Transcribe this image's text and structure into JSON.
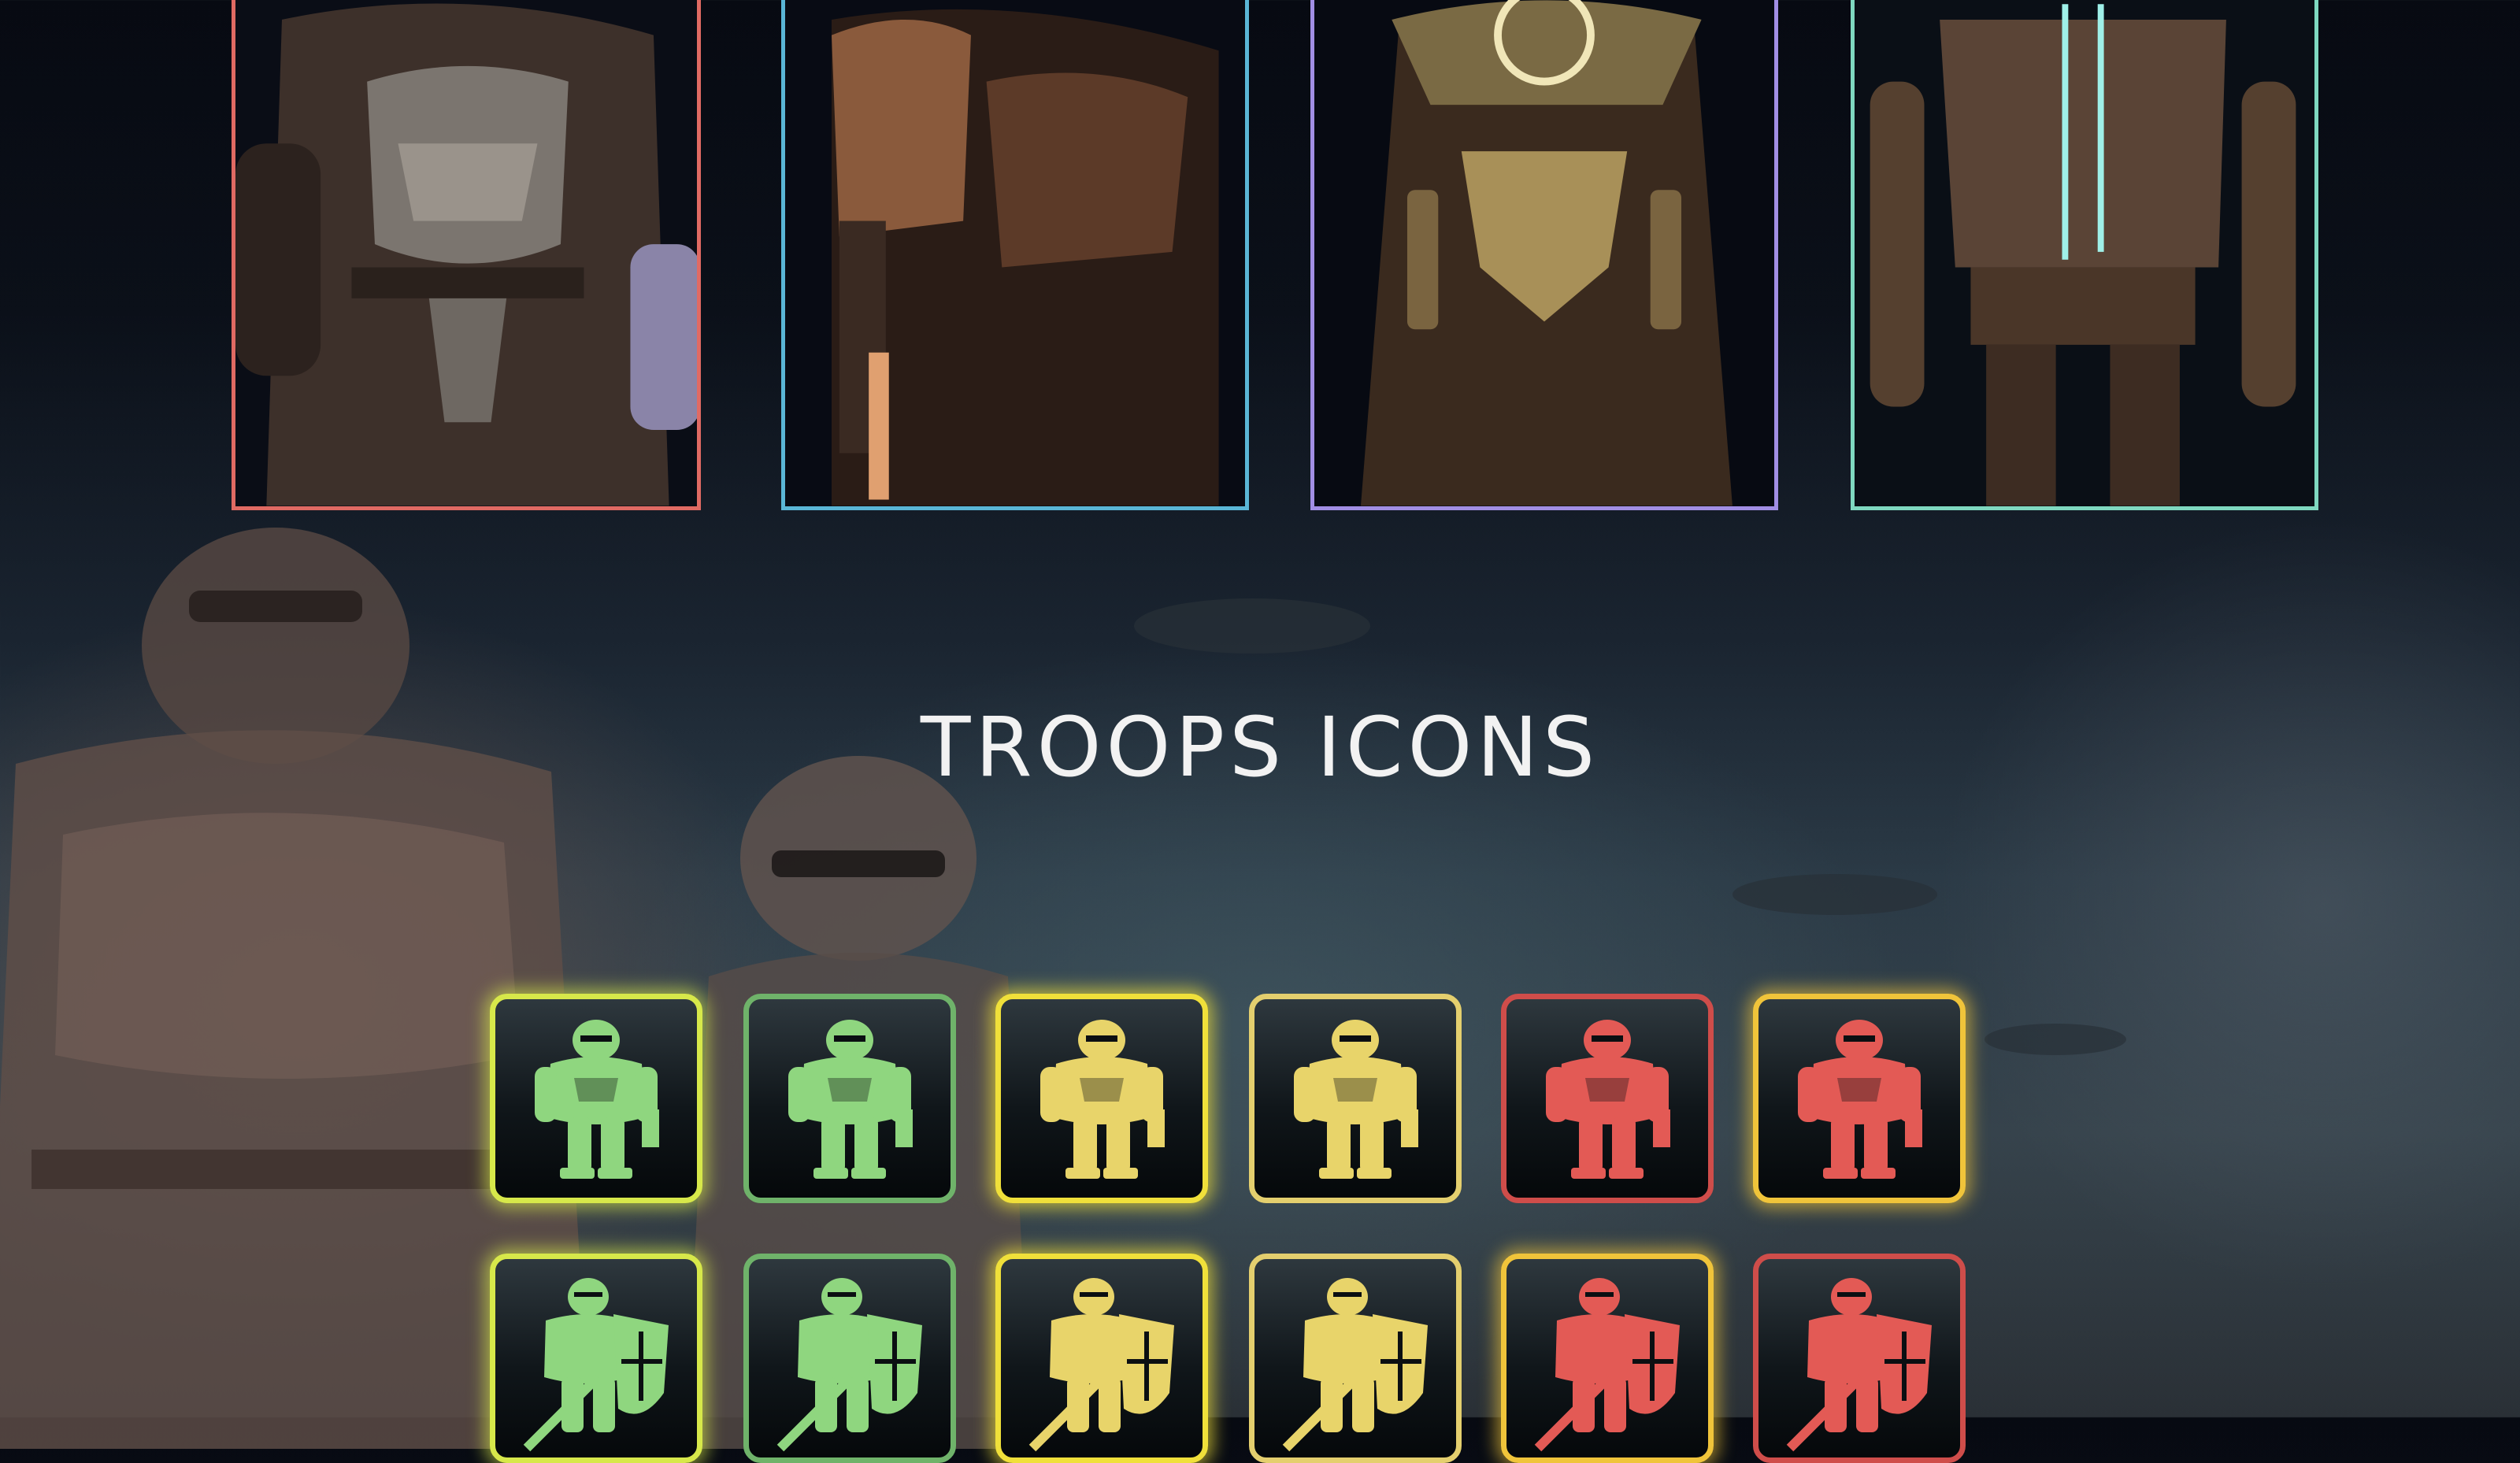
{
  "section": {
    "title": "TROOPS ICONS"
  },
  "cards": [
    {
      "name": "card-raider",
      "accent": "#e06a63"
    },
    {
      "name": "card-trooper",
      "accent": "#5ab6d6"
    },
    {
      "name": "card-priest",
      "accent": "#a18ee4"
    },
    {
      "name": "card-droid",
      "accent": "#7fd8c0"
    }
  ],
  "icons": {
    "row1": [
      {
        "icon": "armored-soldier-icon",
        "color": "#8fd67f",
        "frame": "glow-green"
      },
      {
        "icon": "armored-soldier-icon",
        "color": "#8fd67f",
        "frame": "plain-green"
      },
      {
        "icon": "armored-soldier-icon",
        "color": "#e8d46a",
        "frame": "glow-yellow"
      },
      {
        "icon": "armored-soldier-icon",
        "color": "#e8d46a",
        "frame": "plain-yellow"
      },
      {
        "icon": "armored-soldier-icon",
        "color": "#e35a55",
        "frame": "plain-red"
      },
      {
        "icon": "armored-soldier-icon",
        "color": "#e35a55",
        "frame": "glow-red"
      }
    ],
    "row2": [
      {
        "icon": "shield-knight-icon",
        "color": "#8fd67f",
        "frame": "glow-green"
      },
      {
        "icon": "shield-knight-icon",
        "color": "#8fd67f",
        "frame": "plain-green"
      },
      {
        "icon": "shield-knight-icon",
        "color": "#e8d46a",
        "frame": "glow-yellow"
      },
      {
        "icon": "shield-knight-icon",
        "color": "#e8d46a",
        "frame": "plain-yellow"
      },
      {
        "icon": "shield-knight-icon",
        "color": "#e35a55",
        "frame": "glow-red"
      },
      {
        "icon": "shield-knight-icon",
        "color": "#e35a55",
        "frame": "plain-red"
      }
    ]
  }
}
